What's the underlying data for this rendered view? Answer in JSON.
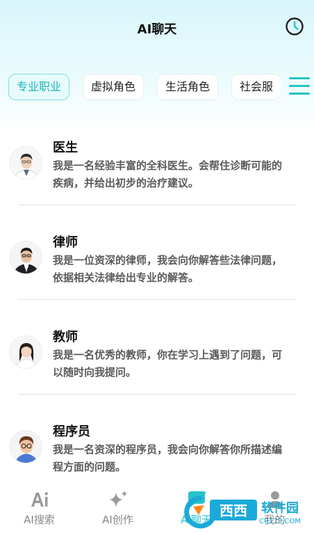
{
  "header": {
    "title": "AI聊天",
    "history_icon": "clock-icon"
  },
  "tabs": [
    {
      "label": "专业职业",
      "active": true
    },
    {
      "label": "虚拟角色",
      "active": false
    },
    {
      "label": "生活角色",
      "active": false
    },
    {
      "label": "社会服",
      "active": false
    }
  ],
  "menu_icon": "hamburger-menu-icon",
  "roles": [
    {
      "name": "医生",
      "desc": "我是一名经验丰富的全科医生。会帮住诊断可能的疾病，并给出初步的治疗建议。"
    },
    {
      "name": "律师",
      "desc": "我是一位资深的律师，我会向你解答些法律问题，依据相关法律给出专业的解答。"
    },
    {
      "name": "教师",
      "desc": "我是一名优秀的教师，你在学习上遇到了问题，可以随时向我提问。"
    },
    {
      "name": "程序员",
      "desc": "我是一名资深的程序员，我会向你解答你所描述编程方面的问题。"
    }
  ],
  "bottom_nav": [
    {
      "label": "AI搜索",
      "icon": "ai-search-icon"
    },
    {
      "label": "AI创作",
      "icon": "sparkle-icon"
    },
    {
      "label": "AI聊天",
      "icon": "chat-bubble-icon"
    },
    {
      "label": "我的",
      "icon": "profile-icon"
    }
  ],
  "watermark": {
    "text": "西西软件园",
    "subtext": "CR173.COM"
  },
  "colors": {
    "accent": "#26c3c8",
    "active_tab_text": "#19b6b9"
  }
}
